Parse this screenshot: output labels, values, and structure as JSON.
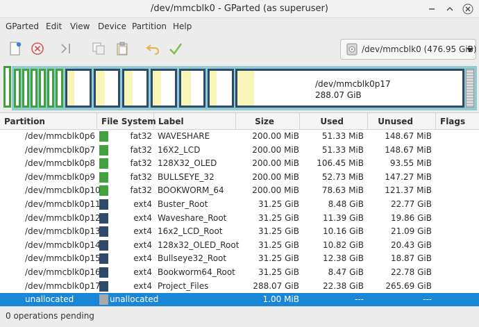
{
  "window": {
    "title": "/dev/mmcblk0 - GParted (as superuser)"
  },
  "menu": [
    "GParted",
    "Edit",
    "View",
    "Device",
    "Partition",
    "Help"
  ],
  "toolbar": {
    "icons": [
      "new-icon",
      "delete-icon",
      "apply-all-icon",
      "copy-icon",
      "paste-icon",
      "undo-icon",
      "apply-icon"
    ]
  },
  "device_selector": {
    "label": "/dev/mmcblk0  (476.95 GiB)"
  },
  "disk_map": {
    "selected_partition": "/dev/mmcblk0p17",
    "selected_size": "288.07 GiB"
  },
  "columns": [
    "Partition",
    "File System",
    "Label",
    "Size",
    "Used",
    "Unused",
    "Flags"
  ],
  "colors": {
    "fat32": "#3fa23a",
    "ext4": "#2d4a6b",
    "unallocated": "#a9a9a9",
    "selection": "#1a86d6",
    "map_border": "#8fcbd0"
  },
  "rows": [
    {
      "partition": "/dev/mmcblk0p6",
      "fs": "fat32",
      "label": "WAVESHARE",
      "size": "200.00 MiB",
      "used": "51.33 MiB",
      "unused": "148.67 MiB",
      "flags": ""
    },
    {
      "partition": "/dev/mmcblk0p7",
      "fs": "fat32",
      "label": "16X2_LCD",
      "size": "200.00 MiB",
      "used": "51.33 MiB",
      "unused": "148.67 MiB",
      "flags": ""
    },
    {
      "partition": "/dev/mmcblk0p8",
      "fs": "fat32",
      "label": "128X32_OLED",
      "size": "200.00 MiB",
      "used": "106.45 MiB",
      "unused": "93.55 MiB",
      "flags": ""
    },
    {
      "partition": "/dev/mmcblk0p9",
      "fs": "fat32",
      "label": "BULLSEYE_32",
      "size": "200.00 MiB",
      "used": "52.73 MiB",
      "unused": "147.27 MiB",
      "flags": ""
    },
    {
      "partition": "/dev/mmcblk0p10",
      "fs": "fat32",
      "label": "BOOKWORM_64",
      "size": "200.00 MiB",
      "used": "78.63 MiB",
      "unused": "121.37 MiB",
      "flags": ""
    },
    {
      "partition": "/dev/mmcblk0p11",
      "fs": "ext4",
      "label": "Buster_Root",
      "size": "31.25 GiB",
      "used": "8.48 GiB",
      "unused": "22.77 GiB",
      "flags": ""
    },
    {
      "partition": "/dev/mmcblk0p12",
      "fs": "ext4",
      "label": "Waveshare_Root",
      "size": "31.25 GiB",
      "used": "11.39 GiB",
      "unused": "19.86 GiB",
      "flags": ""
    },
    {
      "partition": "/dev/mmcblk0p13",
      "fs": "ext4",
      "label": "16x2_LCD_Root",
      "size": "31.25 GiB",
      "used": "10.16 GiB",
      "unused": "21.09 GiB",
      "flags": ""
    },
    {
      "partition": "/dev/mmcblk0p14",
      "fs": "ext4",
      "label": "128x32_OLED_Root",
      "size": "31.25 GiB",
      "used": "10.82 GiB",
      "unused": "20.43 GiB",
      "flags": ""
    },
    {
      "partition": "/dev/mmcblk0p15",
      "fs": "ext4",
      "label": "Bullseye32_Root",
      "size": "31.25 GiB",
      "used": "12.38 GiB",
      "unused": "18.87 GiB",
      "flags": ""
    },
    {
      "partition": "/dev/mmcblk0p16",
      "fs": "ext4",
      "label": "Bookworm64_Root",
      "size": "31.25 GiB",
      "used": "8.47 GiB",
      "unused": "22.78 GiB",
      "flags": ""
    },
    {
      "partition": "/dev/mmcblk0p17",
      "fs": "ext4",
      "label": "Project_Files",
      "size": "288.07 GiB",
      "used": "22.38 GiB",
      "unused": "265.69 GiB",
      "flags": ""
    },
    {
      "partition": "unallocated",
      "fs": "unallocated",
      "label": "",
      "size": "1.00 MiB",
      "used": "---",
      "unused": "---",
      "flags": "",
      "selected": true
    }
  ],
  "status": {
    "text": "0 operations pending"
  }
}
